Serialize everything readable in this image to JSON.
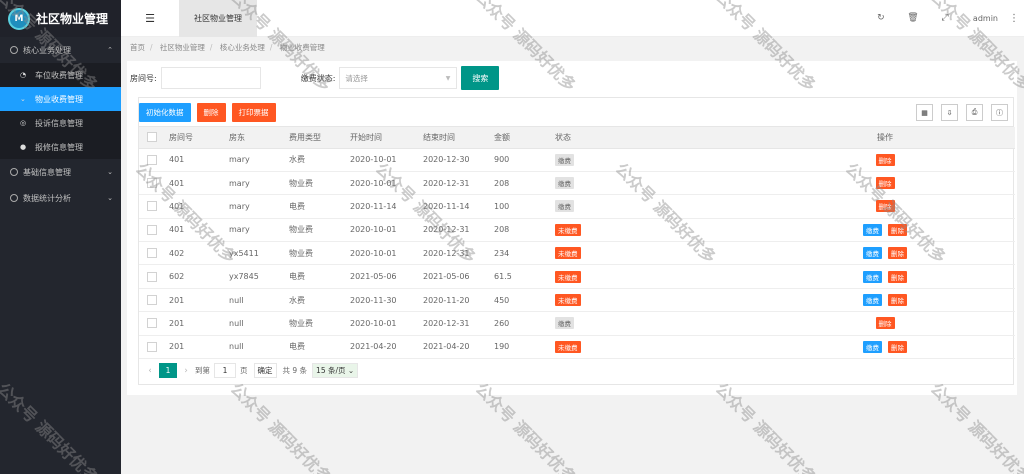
{
  "app": {
    "title": "社区物业管理",
    "logo_letter": "M"
  },
  "sidebar": {
    "groups": [
      {
        "label": "核心业务处理",
        "items": [
          {
            "label": "车位收费管理",
            "icon": "gauge-icon"
          },
          {
            "label": "物业收费管理",
            "icon": "chevron-down-icon",
            "active": true
          },
          {
            "label": "投诉信息管理",
            "icon": "target-icon"
          },
          {
            "label": "报修信息管理",
            "icon": "palette-icon"
          }
        ]
      },
      {
        "label": "基础信息管理"
      },
      {
        "label": "数据统计分析"
      }
    ]
  },
  "header": {
    "tab": "社区物业管理",
    "user": "admin"
  },
  "breadcrumb": [
    "首页",
    "社区物业管理",
    "核心业务处理",
    "物业收费管理"
  ],
  "search": {
    "room_label": "房间号:",
    "status_label": "缴费状态:",
    "status_placeholder": "请选择",
    "search_button": "搜索"
  },
  "toolbar": {
    "init": "初始化数据",
    "delete": "删除",
    "print": "打印票据"
  },
  "table": {
    "headers": [
      "房间号",
      "房东",
      "费用类型",
      "开始时间",
      "结束时间",
      "金额",
      "状态",
      "操作"
    ],
    "rows": [
      {
        "room": "401",
        "owner": "mary",
        "type": "水费",
        "start": "2020-10-01",
        "end": "2020-12-30",
        "amount": "900",
        "status": "缴费",
        "paid": true
      },
      {
        "room": "401",
        "owner": "mary",
        "type": "物业费",
        "start": "2020-10-01",
        "end": "2020-12-31",
        "amount": "208",
        "status": "缴费",
        "paid": true
      },
      {
        "room": "401",
        "owner": "mary",
        "type": "电费",
        "start": "2020-11-14",
        "end": "2020-11-14",
        "amount": "100",
        "status": "缴费",
        "paid": true
      },
      {
        "room": "401",
        "owner": "mary",
        "type": "物业费",
        "start": "2020-10-01",
        "end": "2020-12-31",
        "amount": "208",
        "status": "未缴费",
        "paid": false
      },
      {
        "room": "402",
        "owner": "yx5411",
        "type": "物业费",
        "start": "2020-10-01",
        "end": "2020-12-31",
        "amount": "234",
        "status": "未缴费",
        "paid": false
      },
      {
        "room": "602",
        "owner": "yx7845",
        "type": "电费",
        "start": "2021-05-06",
        "end": "2021-05-06",
        "amount": "61.5",
        "status": "未缴费",
        "paid": false
      },
      {
        "room": "201",
        "owner": "null",
        "type": "水费",
        "start": "2020-11-30",
        "end": "2020-11-20",
        "amount": "450",
        "status": "未缴费",
        "paid": false
      },
      {
        "room": "201",
        "owner": "null",
        "type": "物业费",
        "start": "2020-10-01",
        "end": "2020-12-31",
        "amount": "260",
        "status": "缴费",
        "paid": true
      },
      {
        "room": "201",
        "owner": "null",
        "type": "电费",
        "start": "2021-04-20",
        "end": "2021-04-20",
        "amount": "190",
        "status": "未缴费",
        "paid": false
      }
    ],
    "op_pay": "缴费",
    "op_delete": "删除"
  },
  "pager": {
    "current": "1",
    "goto": "到第",
    "page_input": "1",
    "page_unit": "页",
    "confirm": "确定",
    "total": "共 9 条",
    "size": "15 条/页"
  },
  "watermark": "公众号 源码好优多"
}
